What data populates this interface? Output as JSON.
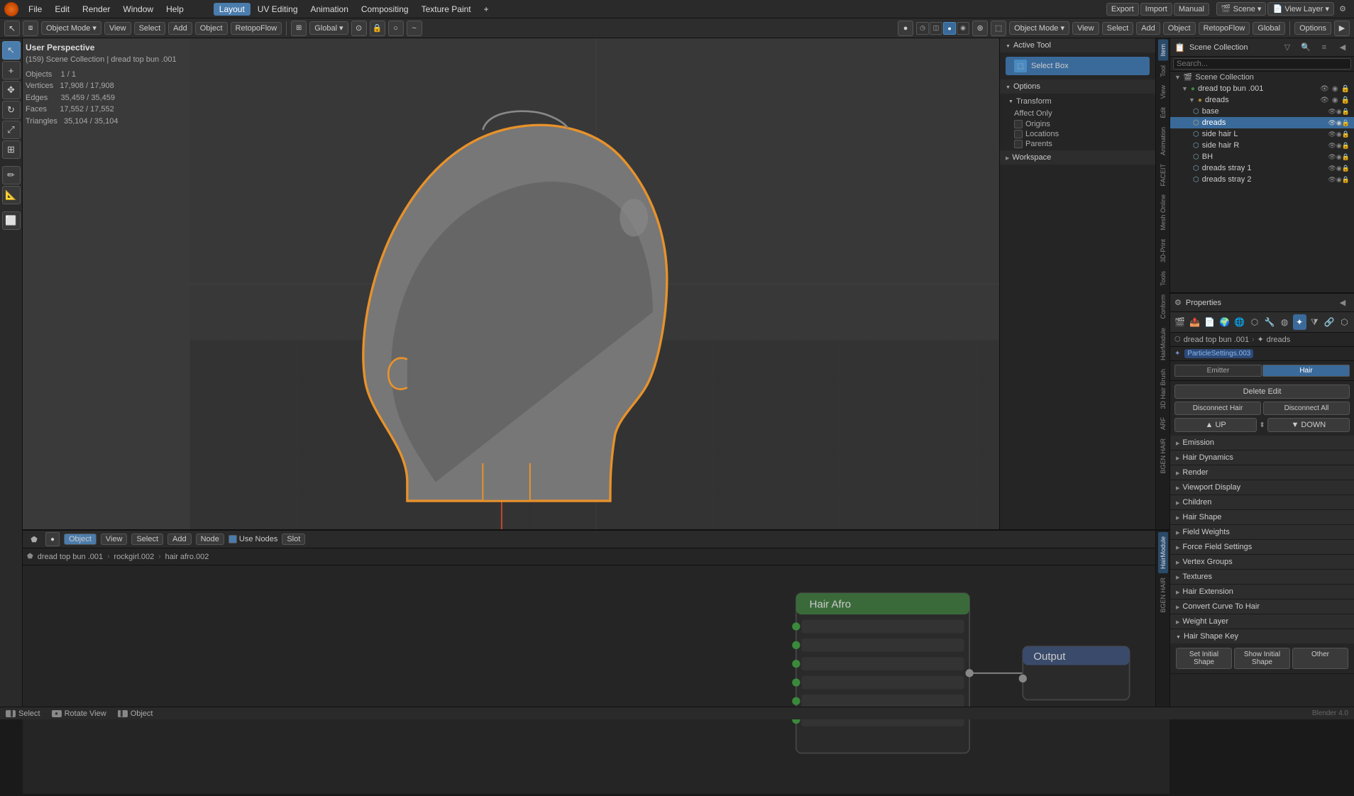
{
  "app": {
    "title": "Blender 4.0"
  },
  "menubar": {
    "items": [
      "Blender",
      "File",
      "Edit",
      "Render",
      "Window",
      "Help"
    ],
    "tabs": [
      "Layout",
      "UV Editing",
      "Animation",
      "Compositing",
      "Texture Paint"
    ],
    "active_tab": "Layout"
  },
  "toolbar_left": {
    "mode": "Object Mode",
    "view_label": "View",
    "select_label": "Select",
    "add_label": "Add",
    "object_label": "Object",
    "retopoflow_label": "RetopoFlow",
    "global_label": "Global"
  },
  "header_right": {
    "object_mode": "Object Mode",
    "view": "View",
    "select": "Select",
    "add": "Add",
    "object": "Object",
    "retopoflow": "RetopoFlow",
    "global": "Global",
    "options": "Options"
  },
  "viewport": {
    "mode": "User Perspective",
    "scene": "(159) Scene Collection | dread top bun .001",
    "objects": "1 / 1",
    "vertices": "17,908 / 17,908",
    "edges": "35,459 / 35,459",
    "faces": "17,552 / 17,552",
    "triangles": "35,104 / 35,104",
    "labels": {
      "objects": "Objects",
      "vertices": "Vertices",
      "edges": "Edges",
      "faces": "Faces",
      "triangles": "Triangles"
    }
  },
  "n_panel": {
    "active_tool_label": "Active Tool",
    "select_box_label": "Select Box",
    "options_label": "Options",
    "transform_label": "Transform",
    "affect_only_label": "Affect Only",
    "origins_label": "Origins",
    "locations_label": "Locations",
    "parents_label": "Parents",
    "workspace_label": "Workspace"
  },
  "right_tabs": [
    "Item",
    "Tool",
    "View",
    "Edit",
    "Animation",
    "FACEIT",
    "Mesh Online",
    "3D-Print",
    "Tools",
    "Conform",
    "HairModule",
    "3D Hair Brush",
    "ARF",
    "BGEN HAIR"
  ],
  "scene_header": {
    "title": "Scene",
    "collection": "Scene Collection",
    "scene_label": "Scene"
  },
  "outliner": {
    "scene_collection_label": "Scene Collection",
    "dread_top_bun_label": "dread top bun .001",
    "dreads_label": "dreads",
    "items": [
      {
        "name": "base",
        "type": "mesh",
        "selected": false
      },
      {
        "name": "dreads",
        "type": "hair",
        "selected": true
      },
      {
        "name": "side hair L",
        "type": "mesh",
        "selected": false
      },
      {
        "name": "side hair R",
        "type": "mesh",
        "selected": false
      },
      {
        "name": "BH",
        "type": "mesh",
        "selected": false
      },
      {
        "name": "dreads stray 1",
        "type": "hair",
        "selected": false
      },
      {
        "name": "dreads stray 2",
        "type": "hair",
        "selected": false
      }
    ]
  },
  "properties": {
    "particle_settings_label": "ParticleSettings.003",
    "emitter_label": "Emitter",
    "hair_label": "Hair",
    "delete_edit_label": "Delete Edit",
    "disconnect_hair_label": "Disconnect Hair",
    "disconnect_all_label": "Disconnect All",
    "up_label": "UP",
    "down_label": "DOWN",
    "sections": [
      {
        "label": "Emission",
        "expanded": false
      },
      {
        "label": "Hair Dynamics",
        "expanded": false
      },
      {
        "label": "Render",
        "expanded": false
      },
      {
        "label": "Viewport Display",
        "expanded": false
      },
      {
        "label": "Children",
        "expanded": false
      },
      {
        "label": "Hair Shape",
        "expanded": false
      },
      {
        "label": "Field Weights",
        "expanded": false
      },
      {
        "label": "Force Field Settings",
        "expanded": false
      },
      {
        "label": "Vertex Groups",
        "expanded": false
      },
      {
        "label": "Textures",
        "expanded": false
      },
      {
        "label": "Hair Extension",
        "expanded": false
      },
      {
        "label": "Convert Curve To Hair",
        "expanded": false
      },
      {
        "label": "Weight Layer",
        "expanded": false
      },
      {
        "label": "Hair Shape Key",
        "expanded": true
      }
    ],
    "hair_shape_key": {
      "set_initial_shape_label": "Set Initial Shape",
      "show_initial_shape_label": "Show Initial Shape",
      "other_label": "Other"
    }
  },
  "node_editor": {
    "header": {
      "object_label": "Object",
      "view_label": "View",
      "select_label": "Select",
      "add_label": "Add",
      "node_label": "Node",
      "use_nodes_label": "Use Nodes",
      "slot_label": "Slot"
    },
    "breadcrumb": {
      "dread_top_bun": "dread top bun .001",
      "rockgirl": "rockgirl.002",
      "hair_afro": "hair afro.002"
    }
  },
  "status_bar": {
    "select_label": "Select",
    "rotate_view_label": "Rotate View",
    "object_label": "Object"
  },
  "colors": {
    "accent_blue": "#3a6a9a",
    "selected_orange": "#e8a050",
    "bg_dark": "#1e1e1e",
    "bg_mid": "#252525",
    "bg_light": "#2d2d2d",
    "border": "#111",
    "text_normal": "#ccc",
    "text_dim": "#888"
  }
}
